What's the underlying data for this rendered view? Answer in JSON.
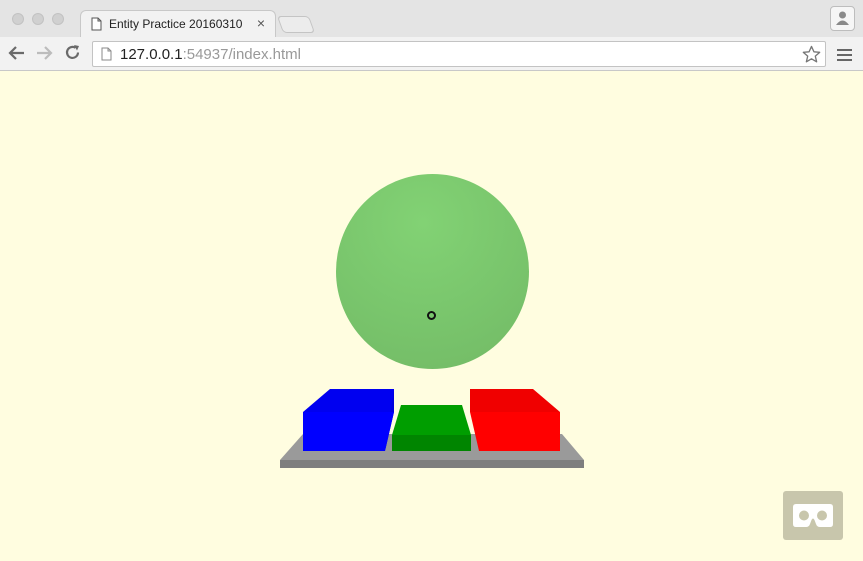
{
  "browser": {
    "tab_title": "Entity Practice 20160310",
    "close_glyph": "×",
    "url_host": "127.0.0.1",
    "url_rest": ":54937/index.html"
  },
  "scene": {
    "background": "#fffde0",
    "sphere_color": "#7cc36d",
    "box_colors": [
      "#0000ff",
      "#009300",
      "#ff0000"
    ],
    "platform_color": "#9a9a9a",
    "vr_button_icon": "vr-cardboard-icon"
  }
}
